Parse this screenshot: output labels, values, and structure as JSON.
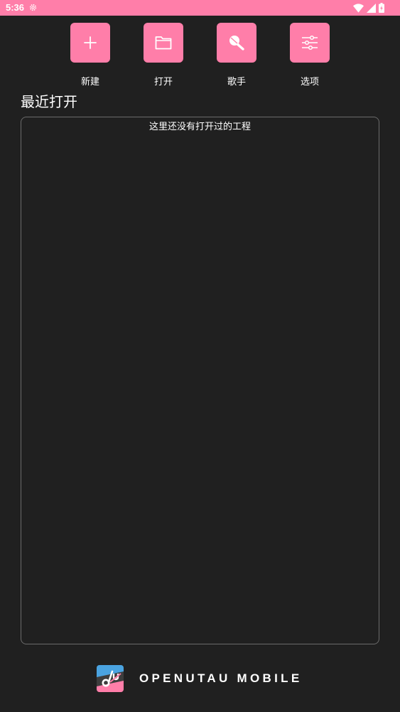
{
  "status_bar": {
    "time": "5:36",
    "icons": [
      "settings-gear-icon",
      "wifi-icon",
      "signal-icon",
      "battery-icon"
    ],
    "background": "#ff7ea9"
  },
  "toolbar": {
    "accent_color": "#ff7ea9",
    "items": [
      {
        "label": "新建",
        "icon": "plus-icon"
      },
      {
        "label": "打开",
        "icon": "folder-icon"
      },
      {
        "label": "歌手",
        "icon": "microphone-icon"
      },
      {
        "label": "选项",
        "icon": "sliders-icon"
      }
    ]
  },
  "recent": {
    "title": "最近打开",
    "empty_text": "这里还没有打开过的工程"
  },
  "footer": {
    "app_name": "OPENUTAU MOBILE",
    "logo": "openutau-logo"
  }
}
